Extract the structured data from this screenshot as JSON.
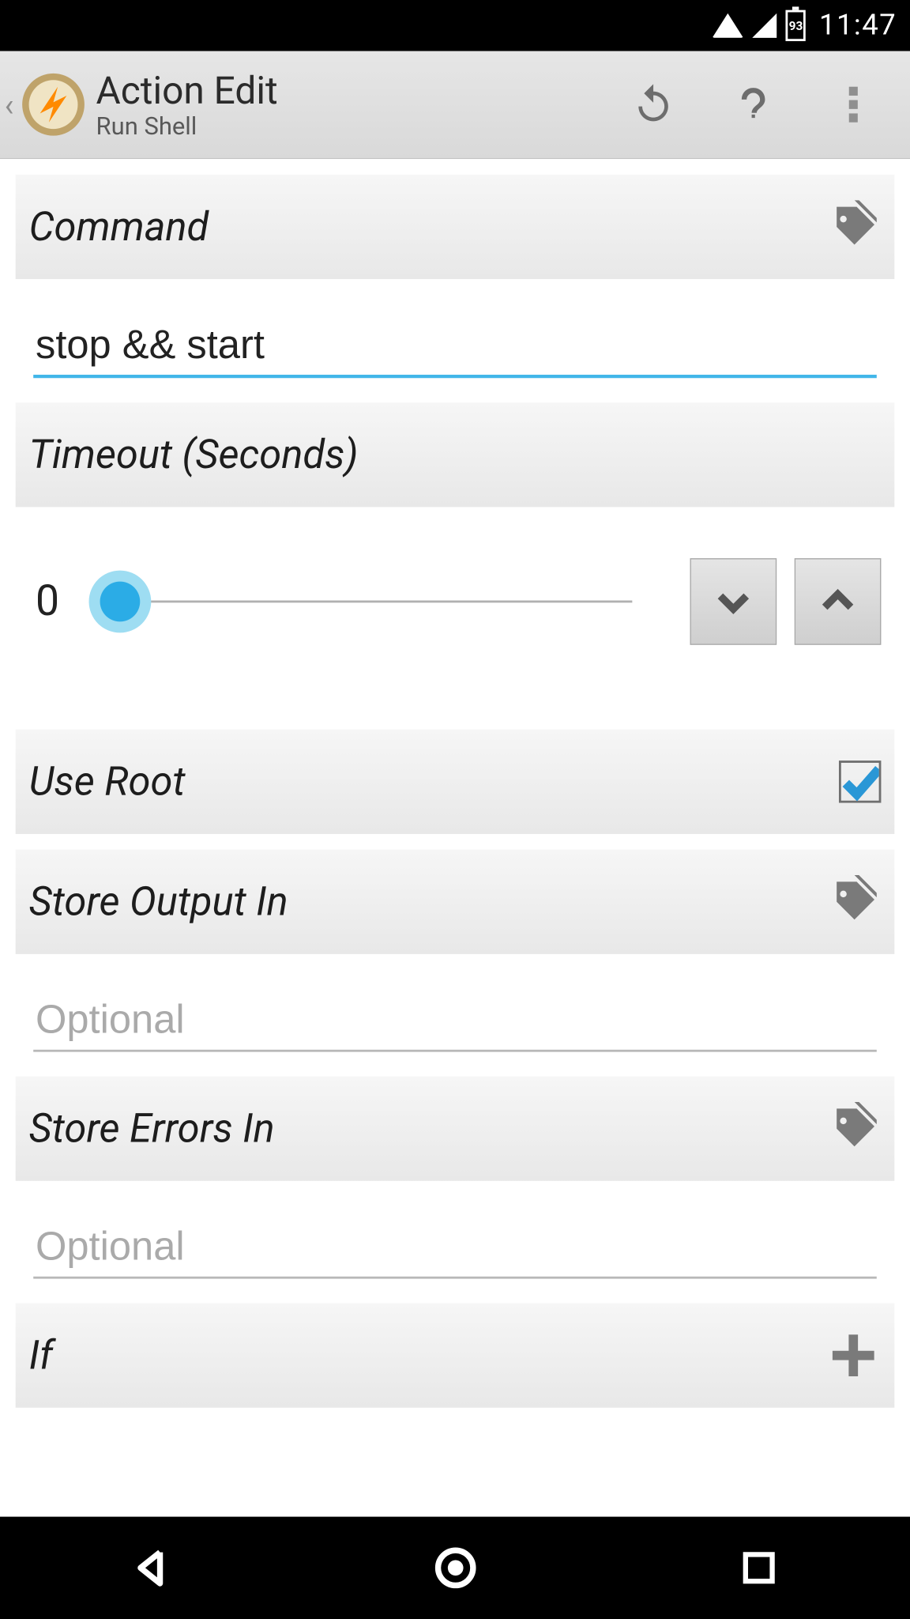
{
  "status": {
    "battery": "93",
    "time": "11:47"
  },
  "actionbar": {
    "title": "Action Edit",
    "subtitle": "Run Shell"
  },
  "command": {
    "label": "Command",
    "value": "stop && start"
  },
  "timeout": {
    "label": "Timeout (Seconds)",
    "value": "0"
  },
  "useroot": {
    "label": "Use Root",
    "checked": true
  },
  "storeoutput": {
    "label": "Store Output In",
    "placeholder": "Optional",
    "value": ""
  },
  "storeerrors": {
    "label": "Store Errors In",
    "placeholder": "Optional",
    "value": ""
  },
  "ifsection": {
    "label": "If"
  }
}
